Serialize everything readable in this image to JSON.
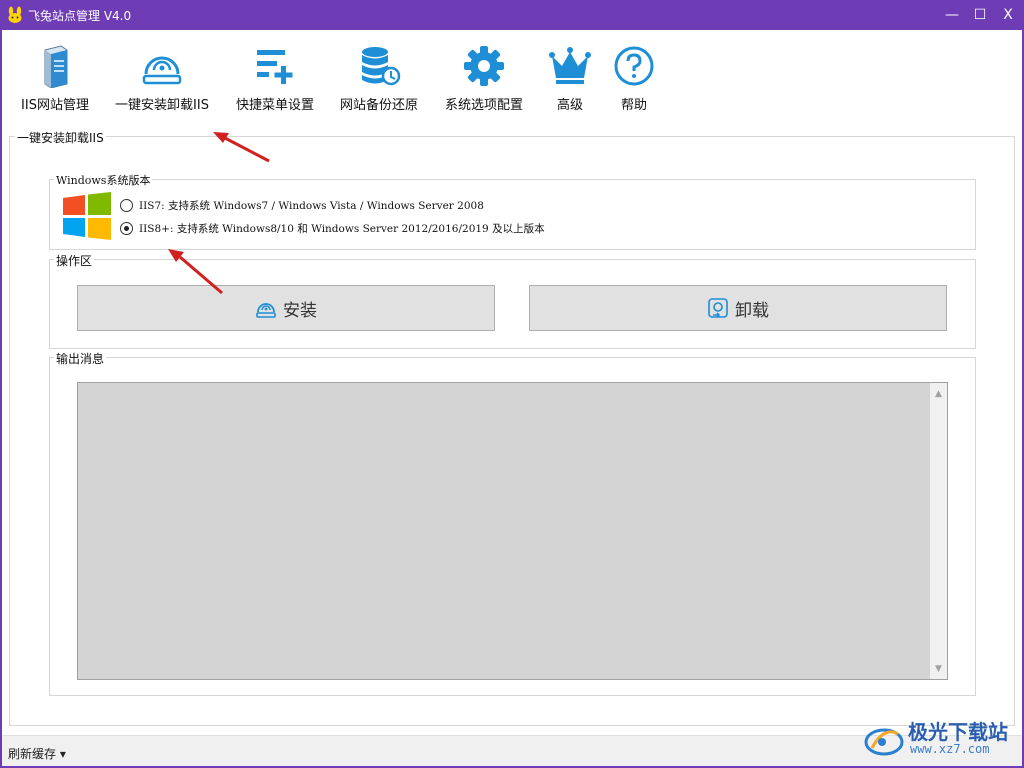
{
  "window": {
    "title": "飞兔站点管理  V4.0",
    "minimize": "—",
    "maximize": "☐",
    "close": "X"
  },
  "toolbar": {
    "items": [
      {
        "label": "IIS网站管理",
        "icon": "server-icon"
      },
      {
        "label": "一键安装卸载IIS",
        "icon": "install-disk-icon"
      },
      {
        "label": "快捷菜单设置",
        "icon": "menu-add-icon"
      },
      {
        "label": "网站备份还原",
        "icon": "database-backup-icon"
      },
      {
        "label": "系统选项配置",
        "icon": "gear-icon"
      },
      {
        "label": "高级",
        "icon": "crown-icon"
      },
      {
        "label": "帮助",
        "icon": "help-icon"
      }
    ]
  },
  "panel": {
    "title": "一键安装卸载IIS",
    "version_group": {
      "title": "Windows系统版本",
      "options": [
        {
          "label": "IIS7: 支持系统 Windows7 / Windows Vista / Windows Server 2008",
          "checked": false
        },
        {
          "label": "IIS8+: 支持系统 Windows8/10 和 Windows Server 2012/2016/2019 及以上版本",
          "checked": true
        }
      ]
    },
    "ops_group": {
      "title": "操作区",
      "install_label": "安装",
      "uninstall_label": "卸载"
    },
    "output_group": {
      "title": "输出消息"
    }
  },
  "statusbar": {
    "refresh_label": "刷新缓存 ▾"
  },
  "watermark": {
    "name": "极光下载站",
    "url": "www.xz7.com"
  },
  "colors": {
    "titlebar": "#6e3cb5",
    "icon_blue": "#1e8fd6",
    "button_bg": "#e1e1e1",
    "output_bg": "#d4d4d4"
  }
}
